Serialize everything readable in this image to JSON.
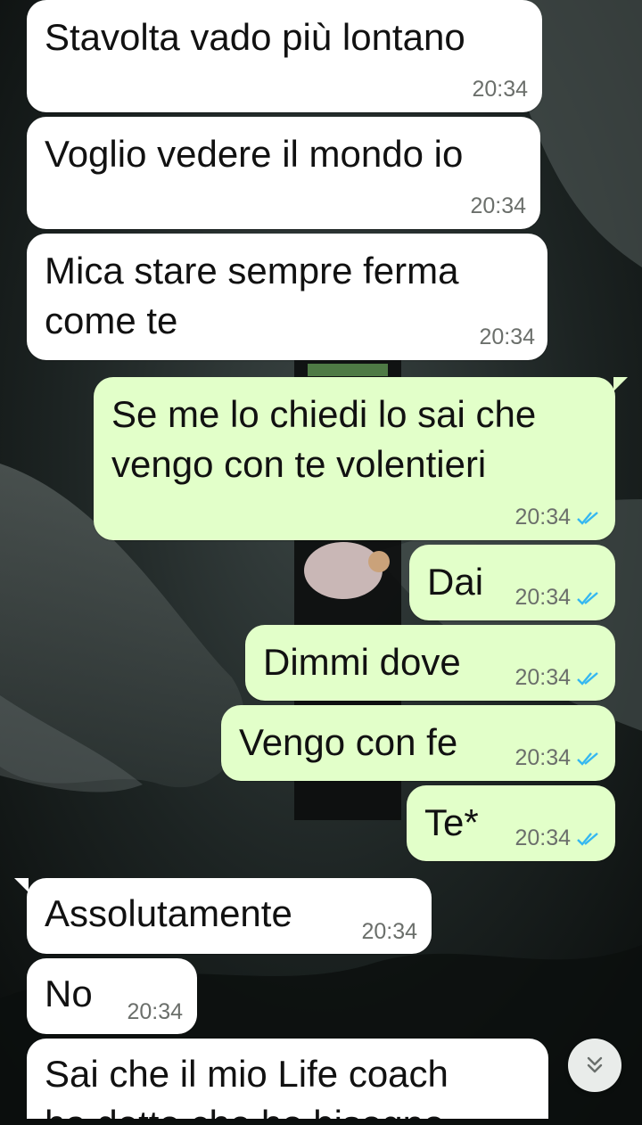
{
  "messages": [
    {
      "direction": "in",
      "text": "Stavolta vado più lontano",
      "time": "20:34"
    },
    {
      "direction": "in",
      "text": "Voglio vedere il mondo io",
      "time": "20:34"
    },
    {
      "direction": "in",
      "text": "Mica stare sempre ferma\ncome te",
      "time": "20:34"
    },
    {
      "direction": "out",
      "text": "Se me lo chiedi lo sai che\nvengo con te volentieri",
      "time": "20:34",
      "status": "double-check-read"
    },
    {
      "direction": "out",
      "text": "Dai",
      "time": "20:34",
      "status": "double-check-read"
    },
    {
      "direction": "out",
      "text": "Dimmi dove",
      "time": "20:34",
      "status": "double-check-read"
    },
    {
      "direction": "out",
      "text": "Vengo con fe",
      "time": "20:34",
      "status": "double-check-read"
    },
    {
      "direction": "out",
      "text": "Te*",
      "time": "20:34",
      "status": "double-check-read"
    },
    {
      "direction": "in",
      "text": "Assolutamente",
      "time": "20:34"
    },
    {
      "direction": "in",
      "text": "No",
      "time": "20:34"
    },
    {
      "direction": "in",
      "text": "Sai che il mio Life coach\nha detto che ho bisogno",
      "time": ""
    }
  ],
  "scroll_button": {
    "icon": "double-chevron-down-icon"
  },
  "colors": {
    "incoming": "#ffffff",
    "outgoing": "#e2ffc9",
    "read_tick": "#34b7f1",
    "timestamp": "#6b6f6b"
  }
}
